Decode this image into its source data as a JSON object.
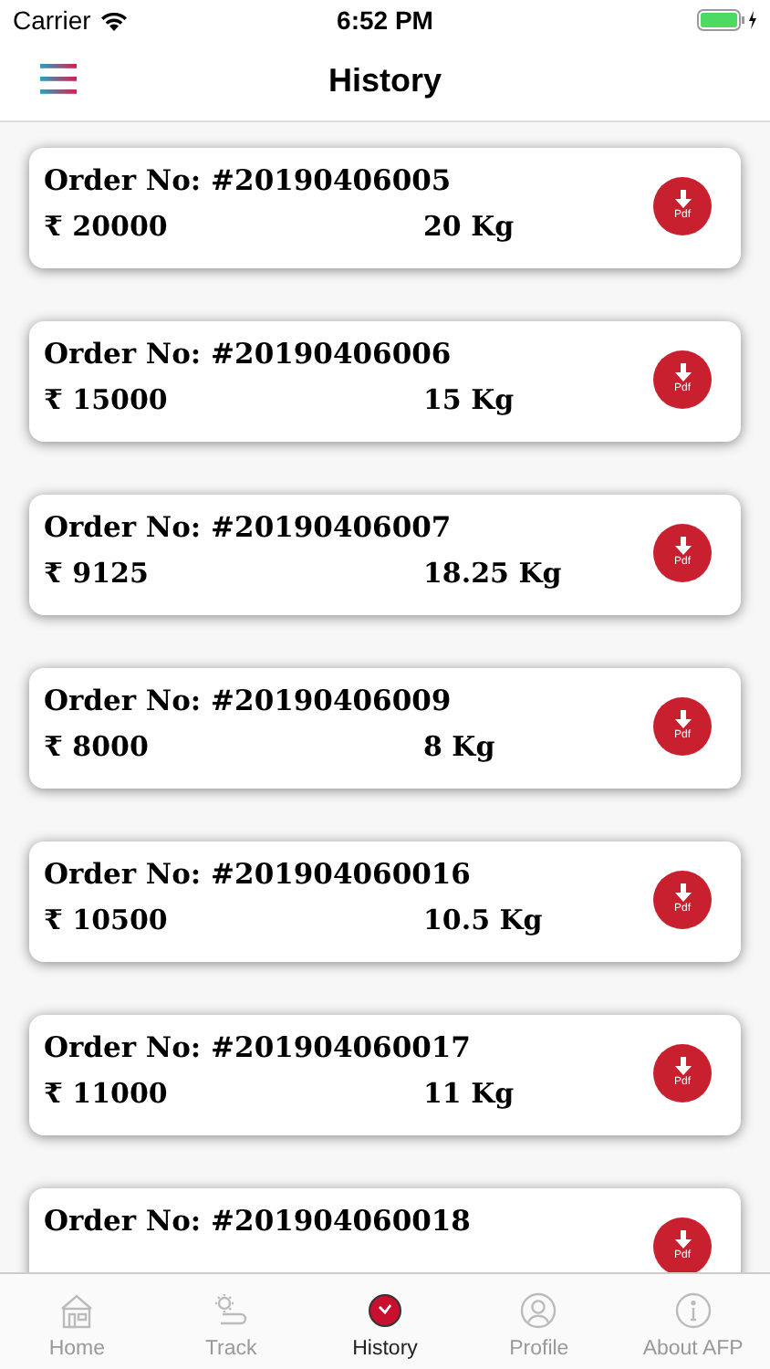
{
  "status_bar": {
    "carrier": "Carrier",
    "time": "6:52 PM"
  },
  "header": {
    "title": "History"
  },
  "orders": [
    {
      "order_no": "Order No: #20190406005",
      "amount": "₹ 20000",
      "weight": "20 Kg",
      "pdf_label": "Pdf"
    },
    {
      "order_no": "Order No: #20190406006",
      "amount": "₹ 15000",
      "weight": "15 Kg",
      "pdf_label": "Pdf"
    },
    {
      "order_no": "Order No: #20190406007",
      "amount": "₹ 9125",
      "weight": "18.25 Kg",
      "pdf_label": "Pdf"
    },
    {
      "order_no": "Order No: #20190406009",
      "amount": "₹ 8000",
      "weight": "8 Kg",
      "pdf_label": "Pdf"
    },
    {
      "order_no": "Order No: #201904060016",
      "amount": "₹ 10500",
      "weight": "10.5 Kg",
      "pdf_label": "Pdf"
    },
    {
      "order_no": "Order No: #201904060017",
      "amount": "₹ 11000",
      "weight": "11 Kg",
      "pdf_label": "Pdf"
    },
    {
      "order_no": "Order No: #201904060018",
      "pdf_label": "Pdf"
    }
  ],
  "tab_bar": [
    {
      "label": "Home",
      "kind": "home",
      "selected": false
    },
    {
      "label": "Track",
      "kind": "track",
      "selected": false
    },
    {
      "label": "History",
      "kind": "history",
      "selected": true
    },
    {
      "label": "Profile",
      "kind": "profile",
      "selected": false
    },
    {
      "label": "About AFP",
      "kind": "about",
      "selected": false
    }
  ]
}
